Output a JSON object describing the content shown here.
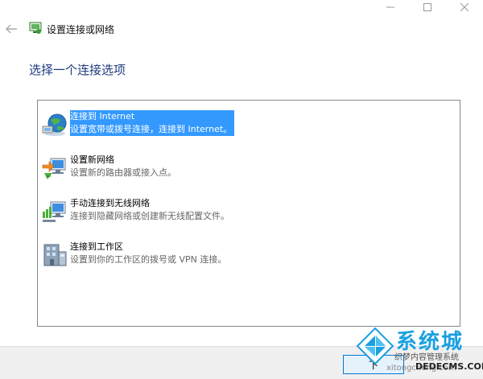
{
  "window": {
    "title": "设置连接或网络",
    "controls": {
      "minimize_icon": "minimize-icon",
      "maximize_icon": "maximize-icon",
      "close_icon": "close-icon"
    }
  },
  "page": {
    "heading": "选择一个连接选项"
  },
  "options": [
    {
      "title": "连接到 Internet",
      "desc": "设置宽带或拨号连接，连接到 Internet。",
      "icon": "globe-network-icon",
      "selected": true
    },
    {
      "title": "设置新网络",
      "desc": "设置新的路由器或接入点。",
      "icon": "new-network-icon",
      "selected": false
    },
    {
      "title": "手动连接到无线网络",
      "desc": "连接到隐藏网络或创建新无线配置文件。",
      "icon": "wireless-network-icon",
      "selected": false
    },
    {
      "title": "连接到工作区",
      "desc": "设置到你的工作区的拨号或 VPN 连接。",
      "icon": "workplace-icon",
      "selected": false
    }
  ],
  "footer": {
    "next_label": "下"
  },
  "watermark": {
    "brand": "系统城",
    "site": "织梦内容管理系统",
    "host": "DEDECMS.COM",
    "host2": "xitongcheng.com"
  },
  "colors": {
    "heading": "#1d3b7e",
    "selection": "#3399ff",
    "accent": "#0078d7"
  }
}
